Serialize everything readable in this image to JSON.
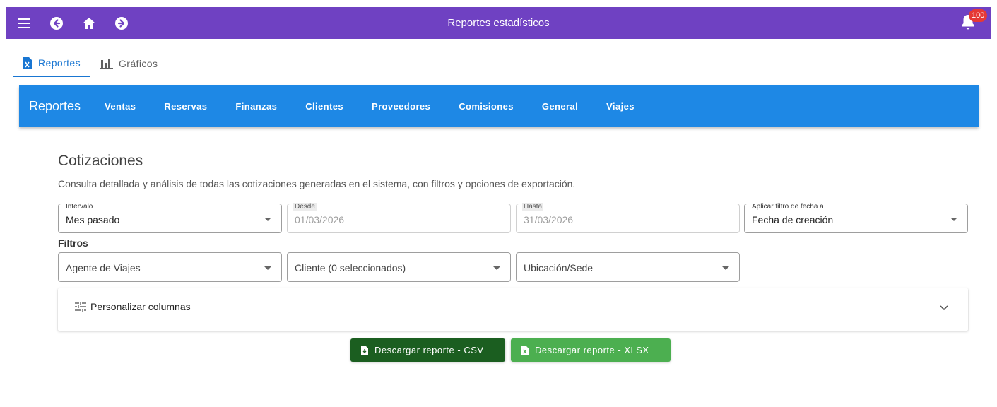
{
  "appbar": {
    "title": "Reportes estadísticos",
    "notification_count": "100",
    "color": "#6f41c2"
  },
  "tabs": [
    {
      "label": "Reportes",
      "icon": "excel-file-icon",
      "active": true
    },
    {
      "label": "Gráficos",
      "icon": "bar-chart-icon",
      "active": false
    }
  ],
  "report_nav": {
    "brand": "Reportes",
    "items": [
      "Ventas",
      "Reservas",
      "Finanzas",
      "Clientes",
      "Proveedores",
      "Comisiones",
      "General",
      "Viajes"
    ],
    "color": "#1e88e5"
  },
  "page": {
    "title": "Cotizaciones",
    "description": "Consulta detallada y análisis de todas las cotizaciones generadas en el sistema, con filtros y opciones de exportación."
  },
  "date_filters": {
    "interval": {
      "label": "Intervalo",
      "value": "Mes pasado"
    },
    "from": {
      "label": "Desde",
      "value": "01/03/2026"
    },
    "to": {
      "label": "Hasta",
      "value": "31/03/2026"
    },
    "apply_to": {
      "label": "Aplicar filtro de fecha a",
      "value": "Fecha de creación"
    }
  },
  "filters": {
    "title": "Filtros",
    "agent": "Agente de Viajes",
    "client": "Cliente (0 seleccionados)",
    "location": "Ubicación/Sede"
  },
  "columns_panel": {
    "label": "Personalizar columnas"
  },
  "buttons": {
    "csv": "Descargar reporte - CSV",
    "xlsx": "Descargar reporte - XLSX",
    "csv_color": "#1b5e20",
    "xlsx_color": "#4caf50"
  }
}
